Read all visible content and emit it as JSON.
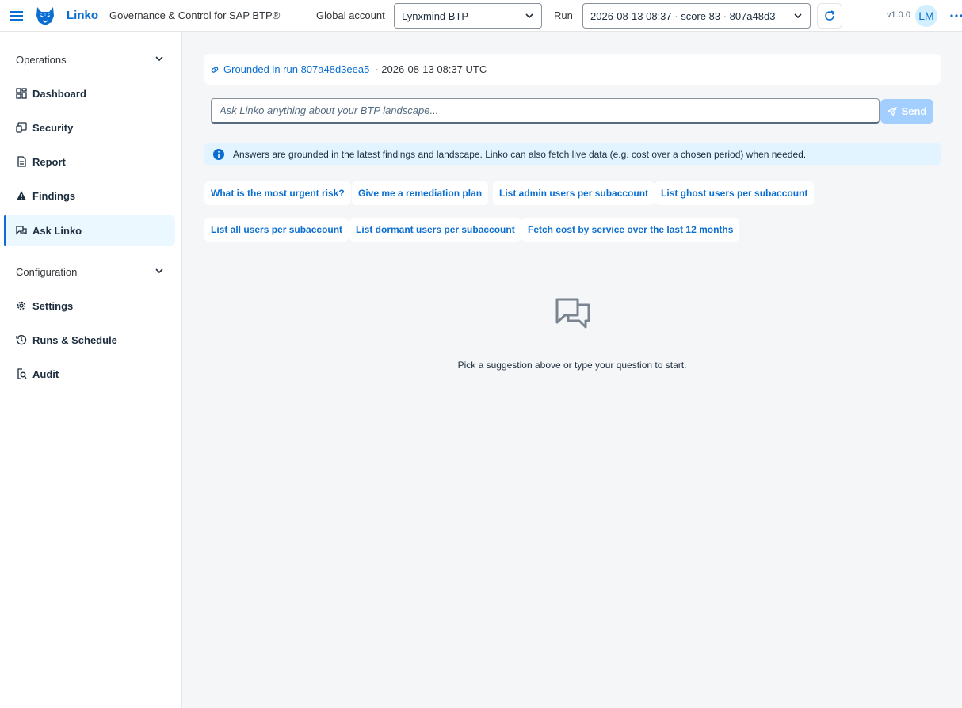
{
  "header": {
    "brand": "Linko",
    "subtitle": "Governance & Control for SAP BTP®",
    "global_account_label": "Global account",
    "global_account_value": "Lynxmind BTP",
    "run_label": "Run",
    "run_value": "2026-08-13 08:37 · score 83 · 807a48d3",
    "version": "v1.0.0",
    "avatar_initials": "LM",
    "icons": {
      "menu": "menu-icon",
      "logo": "lynx-logo",
      "refresh": "refresh-icon",
      "more": "overflow-icon"
    }
  },
  "sidebar": {
    "groups": [
      {
        "label": "Operations"
      },
      {
        "label": "Configuration"
      }
    ],
    "items": [
      {
        "label": "Dashboard",
        "icon": "dashboard-icon"
      },
      {
        "label": "Security",
        "icon": "security-icon"
      },
      {
        "label": "Report",
        "icon": "report-icon"
      },
      {
        "label": "Findings",
        "icon": "warning-icon"
      },
      {
        "label": "Ask Linko",
        "icon": "discussion-icon",
        "active": true
      },
      {
        "label": "Settings",
        "icon": "gear-icon"
      },
      {
        "label": "Runs & Schedule",
        "icon": "history-icon"
      },
      {
        "label": "Audit",
        "icon": "audit-icon"
      }
    ]
  },
  "main": {
    "grounded_link": "Grounded in run 807a48d3eea5",
    "grounded_timestamp": "· 2026-08-13 08:37 UTC",
    "ask_placeholder": "Ask Linko anything about your BTP landscape...",
    "send_label": "Send",
    "info_text": "Answers are grounded in the latest findings and landscape. Linko can also fetch live data (e.g. cost over a chosen period) when needed.",
    "suggestions": [
      "What is the most urgent risk?",
      "Give me a remediation plan",
      "List admin users per subaccount",
      "List ghost users per subaccount",
      "List all users per subaccount",
      "List dormant users per subaccount",
      "Fetch cost by service over the last 12 months"
    ],
    "empty_text": "Pick a suggestion above or type your question to start."
  },
  "colors": {
    "accent": "#0a6ed1",
    "active_bg": "#ebf8ff",
    "info_bg": "#e1f4ff",
    "send_disabled": "#a2cfff"
  }
}
